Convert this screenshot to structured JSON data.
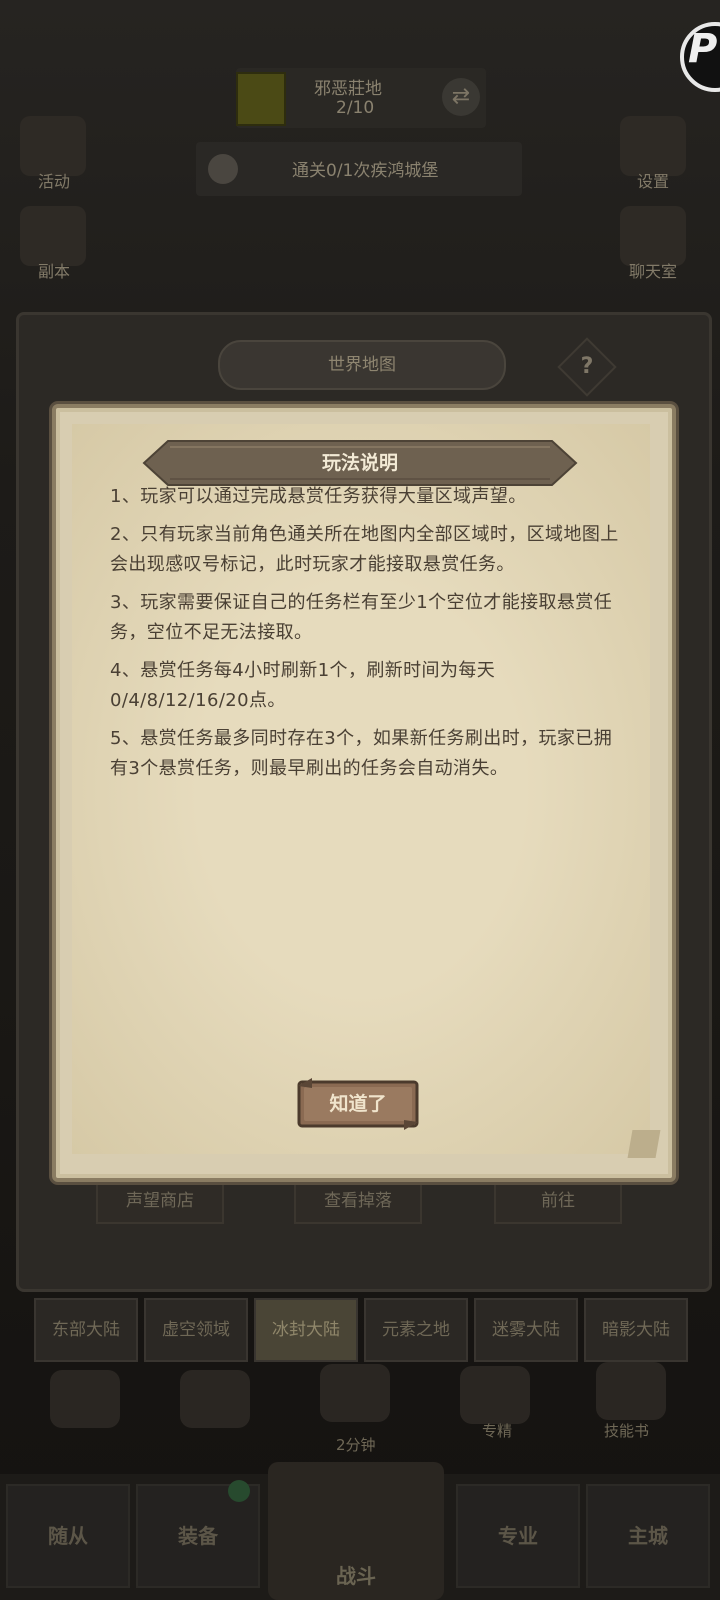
{
  "background": {
    "region_name": "邪恶莊地",
    "region_progress": "2/10",
    "quest_text": "通关0/1次疾鸿城堡",
    "left_icons": [
      {
        "label": "活动"
      },
      {
        "label": "副本"
      }
    ],
    "right_icons": [
      {
        "label": "设置"
      },
      {
        "label": "聊天室"
      }
    ],
    "world_map_title": "世界地图",
    "help_symbol": "?",
    "panel_buttons": [
      "声望商店",
      "查看掉落",
      "前往"
    ],
    "region_tabs": [
      "东部大陆",
      "虚空领域",
      "冰封大陆",
      "元素之地",
      "迷雾大陆",
      "暗影大陆"
    ],
    "active_tab_index": 2,
    "mid_labels": {
      "timer": "2分钟",
      "item_a": "专精",
      "item_b": "技能书"
    },
    "bottom_nav": [
      "随从",
      "装备",
      "战斗",
      "专业",
      "主城"
    ]
  },
  "dialog": {
    "title": "玩法说明",
    "rules": [
      "1、玩家可以通过完成悬赏任务获得大量区域声望。",
      "2、只有玩家当前角色通关所在地图内全部区域时，区域地图上会出现感叹号标记，此时玩家才能接取悬赏任务。",
      "3、玩家需要保证自己的任务栏有至少1个空位才能接取悬赏任务，空位不足无法接取。",
      "4、悬赏任务每4小时刷新1个，刷新时间为每天0/4/8/12/16/20点。",
      "5、悬赏任务最多同时存在3个，如果新任务刷出时，玩家已拥有3个悬赏任务，则最早刷出的任务会自动消失。"
    ],
    "confirm_label": "知道了"
  },
  "colors": {
    "paper": "#e3d7b8",
    "banner": "#6e6150",
    "button_wood": "#8a6a52",
    "text_dark": "#4a4034"
  }
}
